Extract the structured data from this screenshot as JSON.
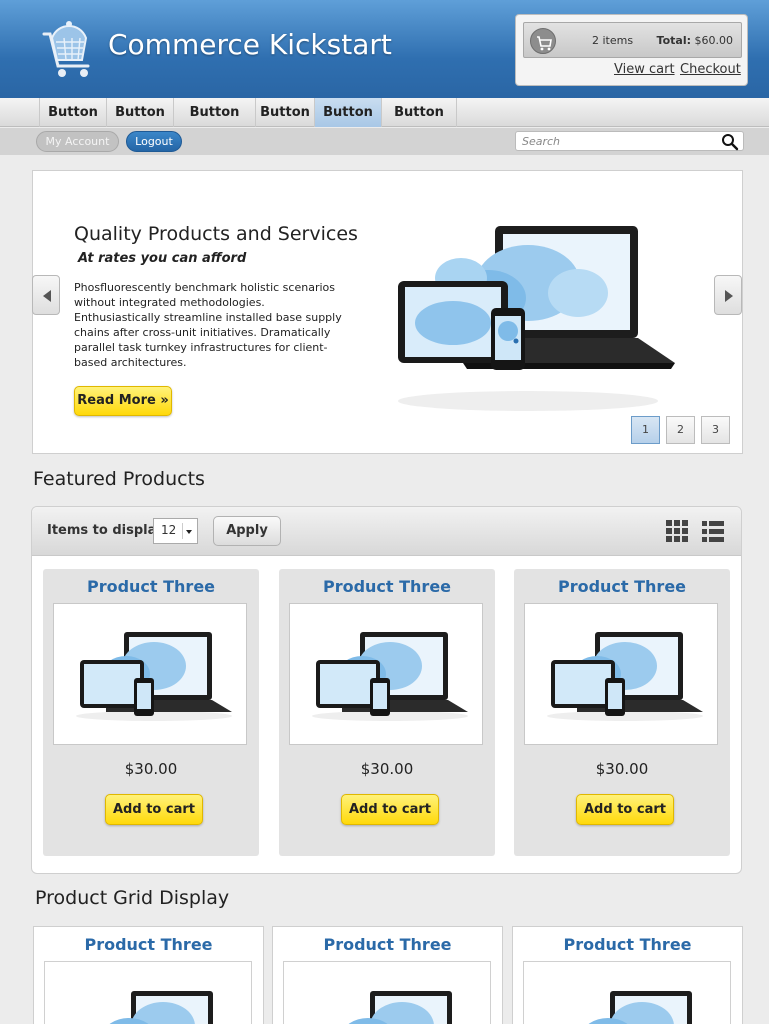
{
  "header": {
    "title": "Commerce Kickstart"
  },
  "cart": {
    "items": "2 items",
    "total_label": "Total:",
    "total_value": "$60.00",
    "view_cart": "View cart",
    "checkout": "Checkout"
  },
  "nav": {
    "items": [
      {
        "label": "Button"
      },
      {
        "label": "Button"
      },
      {
        "label": "Button"
      },
      {
        "label": "Button"
      },
      {
        "label": "Button"
      },
      {
        "label": "Button"
      }
    ],
    "active_index": 4
  },
  "subnav": {
    "account": "My Account",
    "logout": "Logout",
    "search_placeholder": "Search"
  },
  "slider": {
    "title": "Quality Products and Services",
    "subtitle": "At rates you can afford",
    "body": "Phosfluorescently benchmark holistic scenarios without integrated methodologies. Enthusiastically streamline installed base supply chains after cross-unit initiatives. Dramatically parallel task turnkey infrastructures for client-based architectures.",
    "button": "Read More »",
    "pages": [
      "1",
      "2",
      "3"
    ],
    "active_page": 1
  },
  "featured": {
    "heading": "Featured Products",
    "items_label": "Items to display",
    "items_value": "12",
    "apply": "Apply",
    "products": [
      {
        "name": "Product Three",
        "price": "$30.00",
        "button": "Add to cart"
      },
      {
        "name": "Product Three",
        "price": "$30.00",
        "button": "Add to cart"
      },
      {
        "name": "Product Three",
        "price": "$30.00",
        "button": "Add to cart"
      }
    ]
  },
  "grid": {
    "heading": "Product Grid Display",
    "products": [
      {
        "name": "Product Three"
      },
      {
        "name": "Product Three"
      },
      {
        "name": "Product Three"
      }
    ]
  },
  "colors": {
    "header_blue": "#2f6fb0",
    "link_blue": "#2b6aa8",
    "button_yellow": "#ffd90a",
    "nav_active": "#a8c7e6"
  }
}
